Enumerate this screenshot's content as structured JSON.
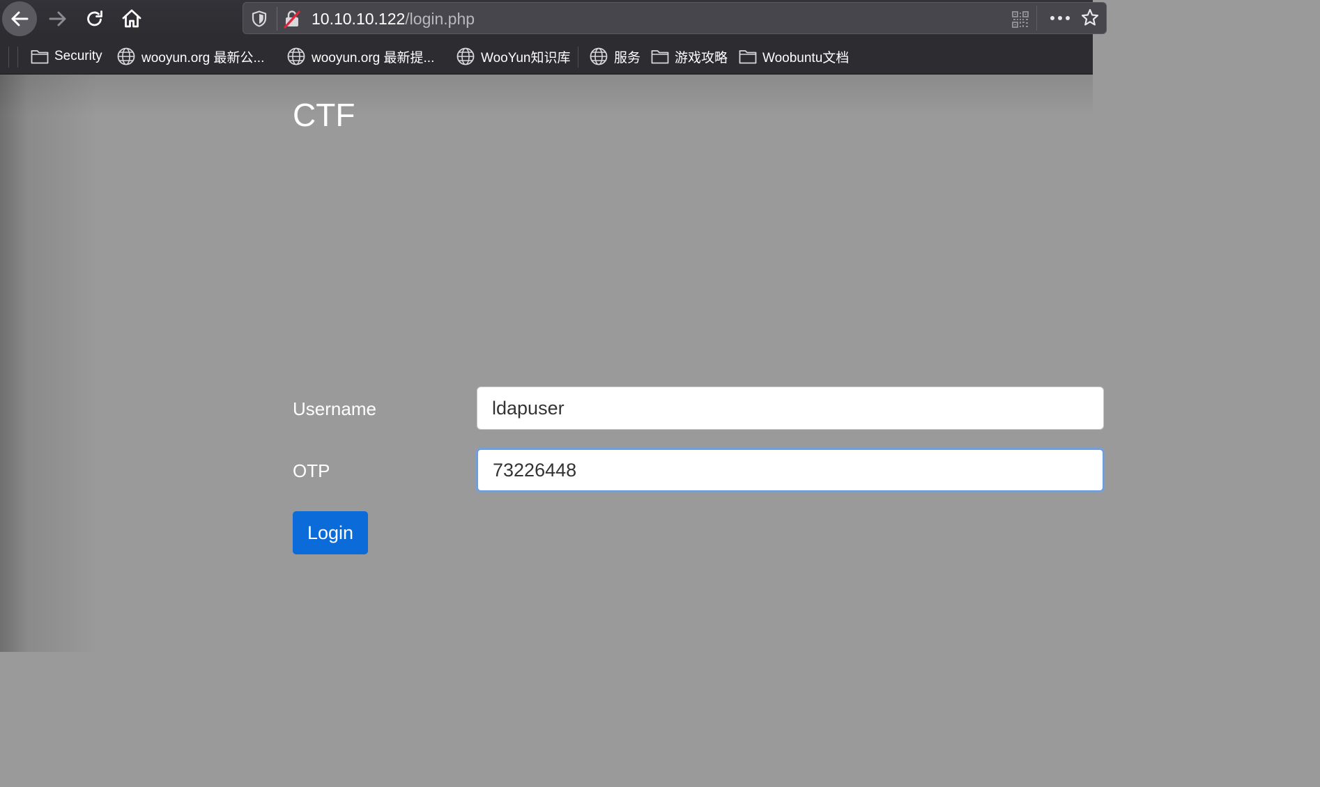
{
  "toolbar": {
    "url_host": "10.10.10.122",
    "url_path": "/login.php"
  },
  "bookmarks": [
    {
      "label": "Security",
      "icon": "folder-icon"
    },
    {
      "label": "wooyun.org 最新公...",
      "icon": "globe-icon"
    },
    {
      "label": "wooyun.org 最新提...",
      "icon": "globe-icon"
    },
    {
      "label": "WooYun知识库",
      "icon": "globe-icon"
    },
    {
      "label": "服务",
      "icon": "globe-icon"
    },
    {
      "label": "游戏攻略",
      "icon": "folder-icon"
    },
    {
      "label": "Woobuntu文档",
      "icon": "folder-icon"
    }
  ],
  "page": {
    "title": "CTF",
    "username_label": "Username",
    "username_value": "ldapuser",
    "otp_label": "OTP",
    "otp_value": "73226448",
    "login_label": "Login"
  }
}
